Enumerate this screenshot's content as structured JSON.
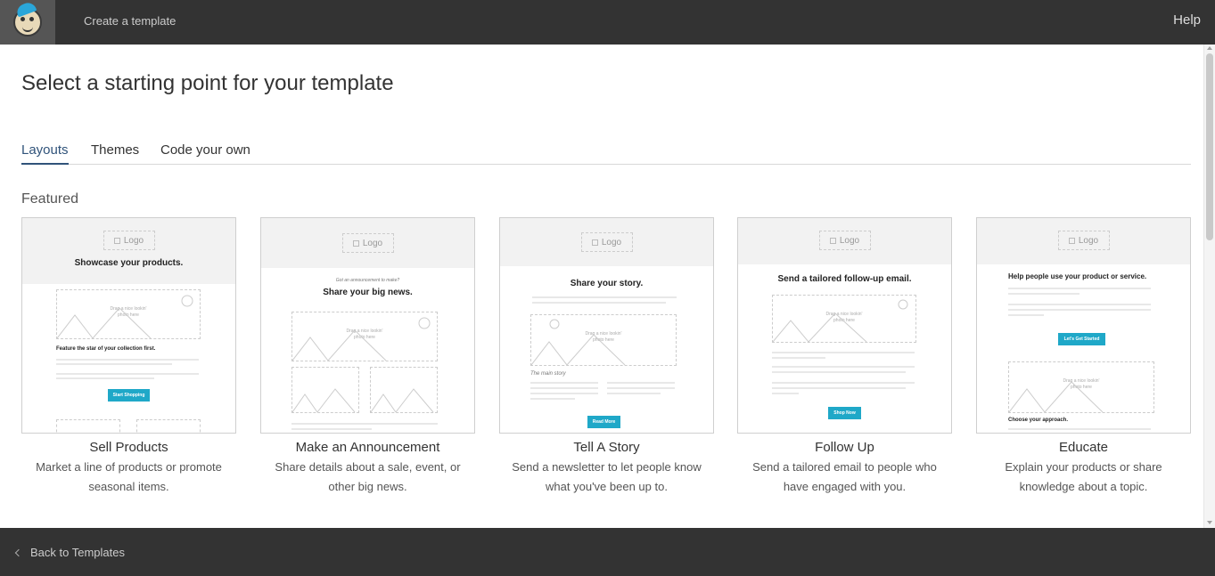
{
  "header": {
    "title": "Create a template",
    "help_label": "Help"
  },
  "page": {
    "title": "Select a starting point for your template",
    "tabs": [
      {
        "label": "Layouts",
        "active": true
      },
      {
        "label": "Themes",
        "active": false
      },
      {
        "label": "Code your own",
        "active": false
      }
    ],
    "section_label": "Featured"
  },
  "preview_texts": {
    "logo": "Logo",
    "image_caption": "Drag a nice lookin' photo here",
    "sell_heading": "Showcase your products.",
    "sell_bold": "Feature the star of your collection first.",
    "sell_button": "Start Shopping",
    "announce_sub": "Got an announcement to make?",
    "announce_heading": "Share your big news.",
    "story_heading": "Share your story.",
    "story_sub": "The main story",
    "story_button": "Read More",
    "follow_heading": "Send a tailored follow-up email.",
    "follow_button": "Shop Now",
    "educate_heading": "Help people use your product or service.",
    "educate_button": "Let's Get Started",
    "educate_bold": "Choose your approach."
  },
  "cards": [
    {
      "name": "Sell Products",
      "description": "Market a line of products or promote seasonal items."
    },
    {
      "name": "Make an Announcement",
      "description": "Share details about a sale, event, or other big news."
    },
    {
      "name": "Tell A Story",
      "description": "Send a newsletter to let people know what you've been up to."
    },
    {
      "name": "Follow Up",
      "description": "Send a tailored email to people who have engaged with you."
    },
    {
      "name": "Educate",
      "description": "Explain your products or share knowledge about a topic."
    }
  ],
  "footer": {
    "back_label": "Back to Templates"
  },
  "colors": {
    "topbar": "#333333",
    "accent_tab": "#30537a",
    "button": "#1fa8c8"
  }
}
